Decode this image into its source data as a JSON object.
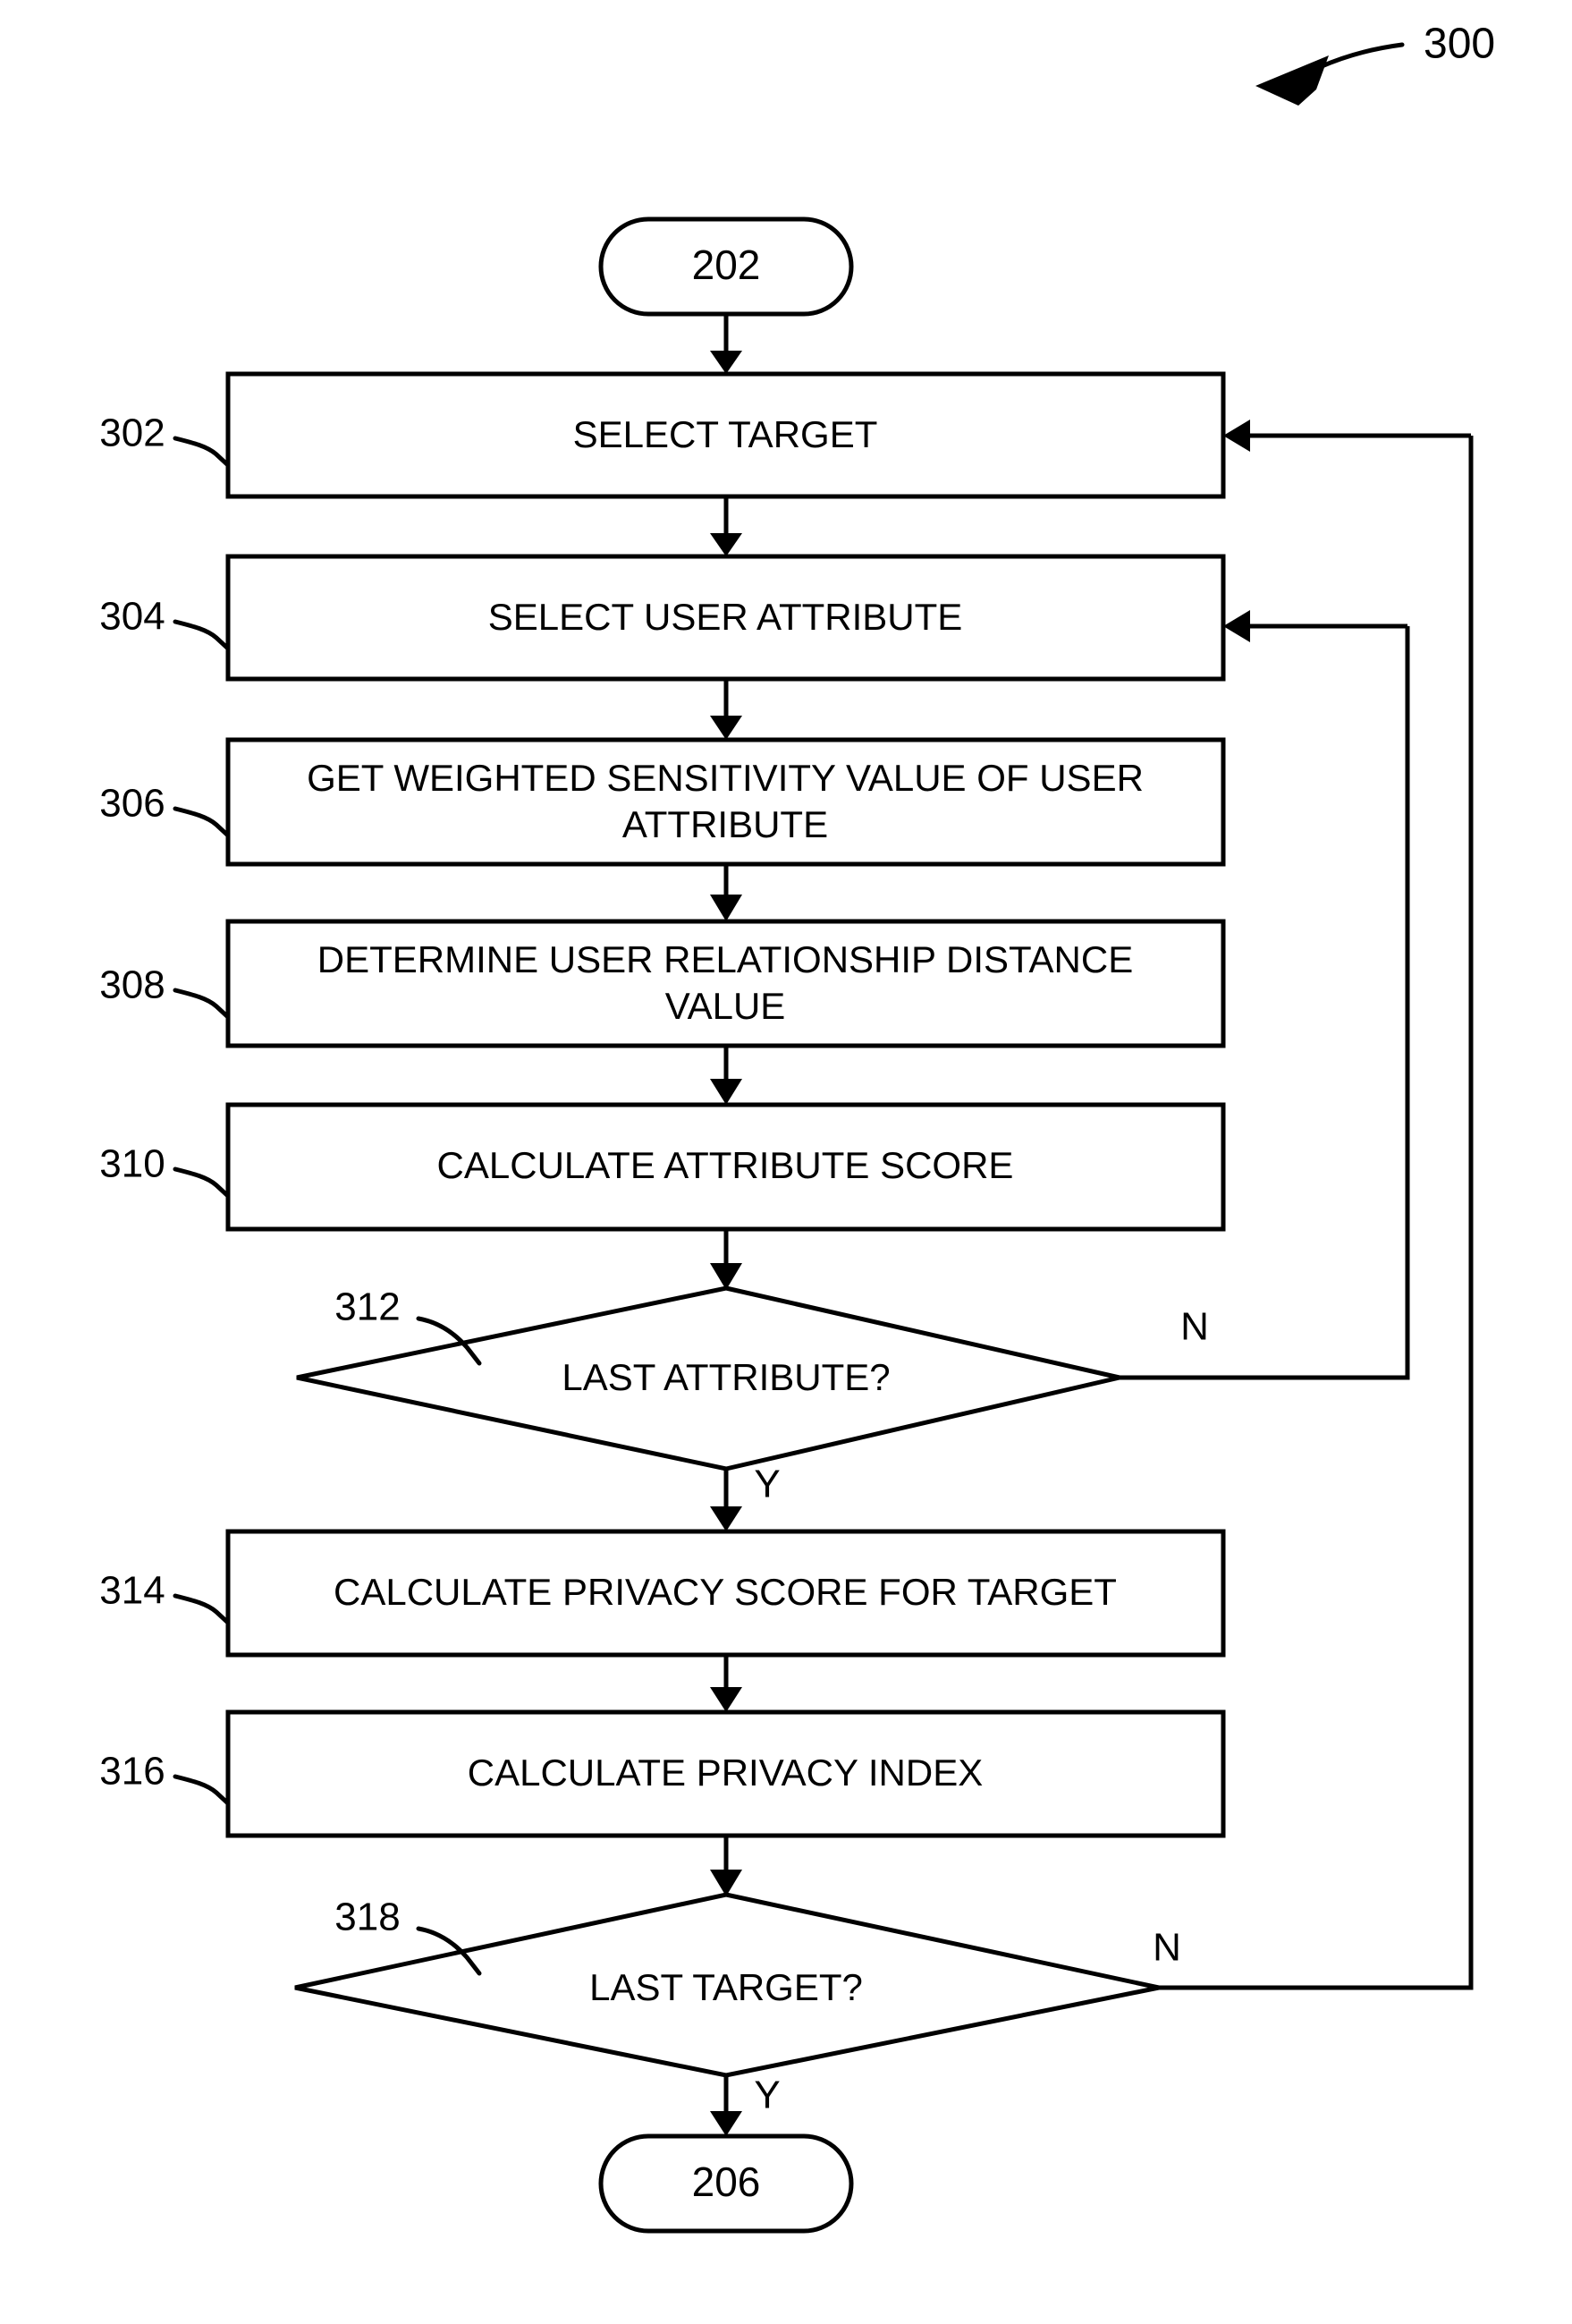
{
  "figure": {
    "label": "300",
    "pointer_icon": "curved-arrow-icon"
  },
  "nodes": {
    "start": {
      "ref": "202",
      "label": "202",
      "shape": "terminator"
    },
    "n302": {
      "ref": "302",
      "label": "SELECT TARGET",
      "shape": "process"
    },
    "n304": {
      "ref": "304",
      "label": "SELECT USER ATTRIBUTE",
      "shape": "process"
    },
    "n306": {
      "ref": "306",
      "line1": "GET WEIGHTED SENSITIVITY VALUE OF USER",
      "line2": "ATTRIBUTE",
      "shape": "process"
    },
    "n308": {
      "ref": "308",
      "line1": "DETERMINE USER RELATIONSHIP DISTANCE",
      "line2": "VALUE",
      "shape": "process"
    },
    "n310": {
      "ref": "310",
      "label": "CALCULATE ATTRIBUTE SCORE",
      "shape": "process"
    },
    "n312": {
      "ref": "312",
      "label": "LAST ATTRIBUTE?",
      "shape": "decision"
    },
    "n314": {
      "ref": "314",
      "label": "CALCULATE PRIVACY SCORE FOR TARGET",
      "shape": "process"
    },
    "n316": {
      "ref": "316",
      "label": "CALCULATE PRIVACY INDEX",
      "shape": "process"
    },
    "n318": {
      "ref": "318",
      "label": "LAST TARGET?",
      "shape": "decision"
    },
    "end": {
      "ref": "206",
      "label": "206",
      "shape": "terminator"
    }
  },
  "branch_labels": {
    "d312_no": "N",
    "d312_yes": "Y",
    "d318_no": "N",
    "d318_yes": "Y"
  },
  "colors": {
    "stroke": "#000000",
    "fill": "#ffffff",
    "background": "#ffffff"
  }
}
